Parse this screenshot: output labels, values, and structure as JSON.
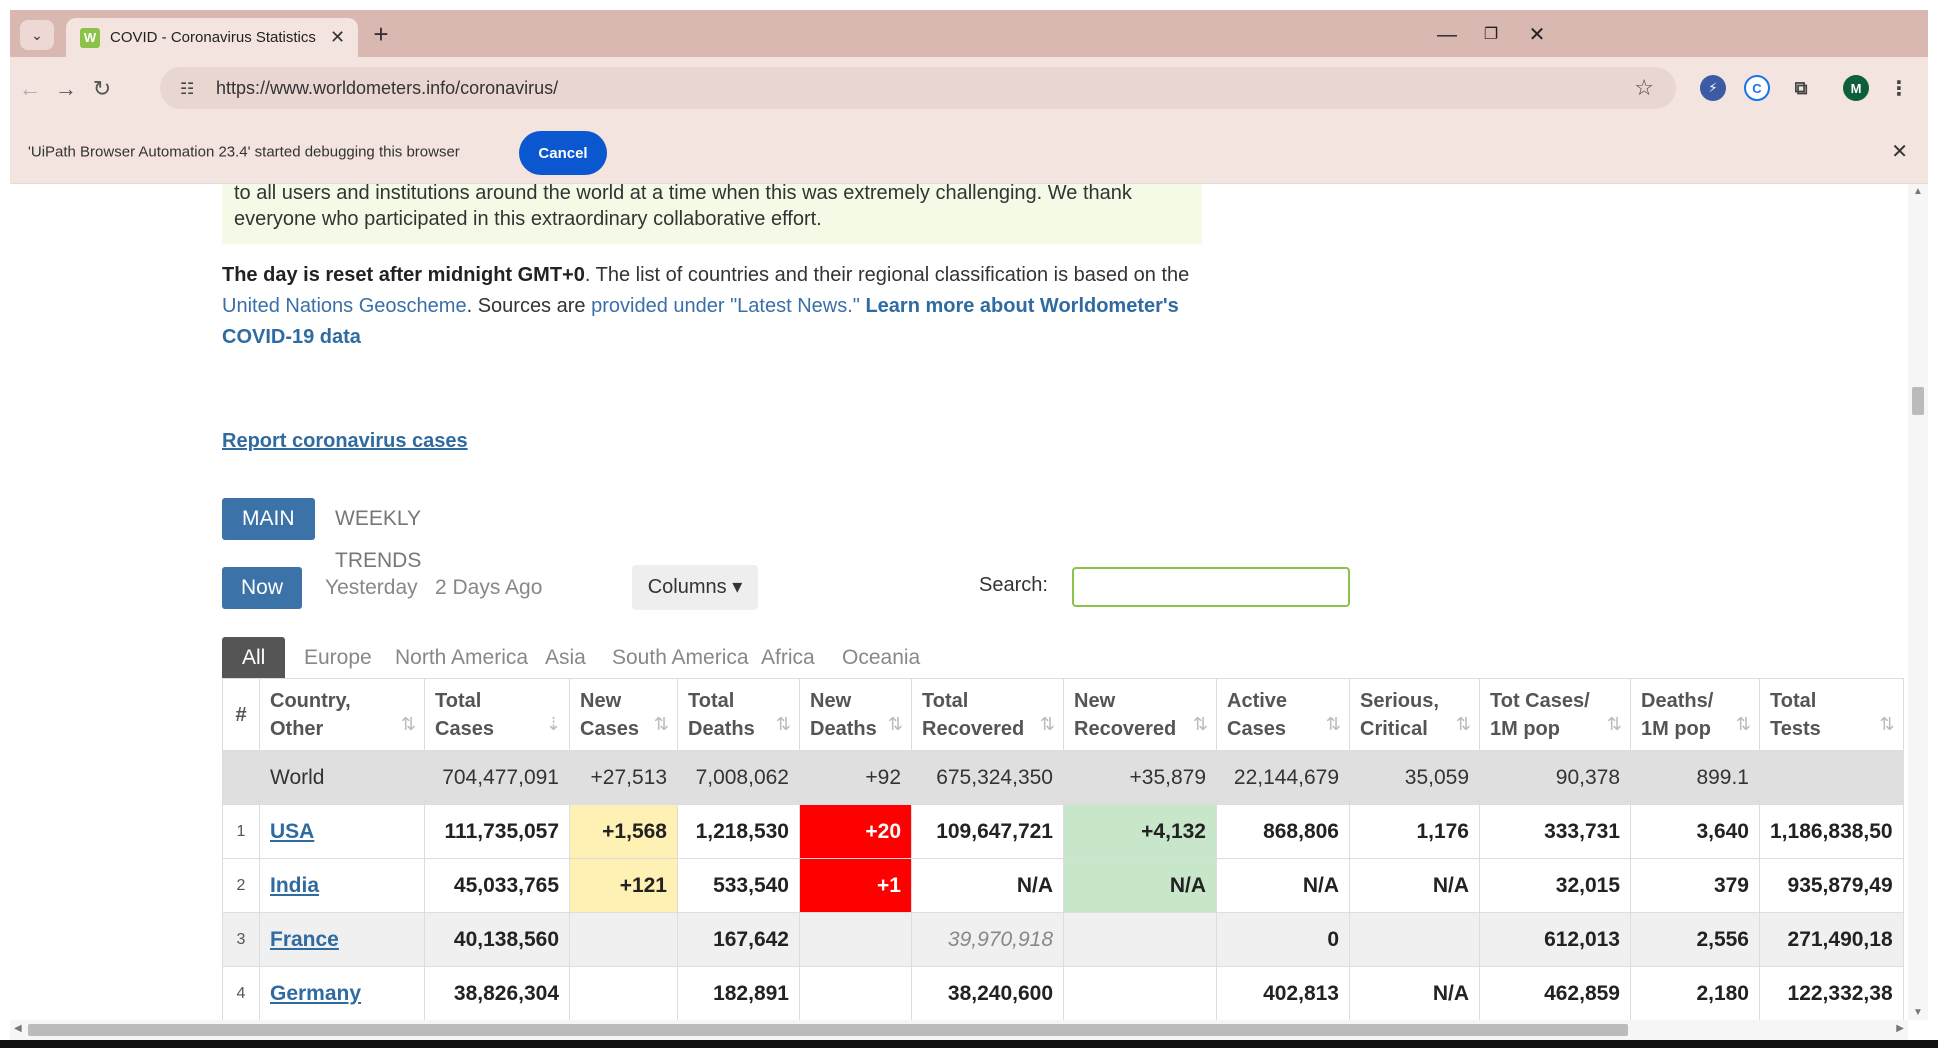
{
  "browser": {
    "tab_title": "COVID - Coronavirus Statistics -",
    "url": "https://www.worldometers.info/coronavirus/",
    "profile_initial": "M",
    "infobar_message": "'UiPath Browser Automation 23.4' started debugging this browser",
    "infobar_cancel": "Cancel"
  },
  "notice": {
    "line1": "to all users and institutions around the world at a time when this was extremely challenging. We thank",
    "line2": "everyone who participated in this extraordinary collaborative effort."
  },
  "info": {
    "bold_start": "The day is reset after midnight GMT+0",
    "text1": ". The list of countries and their regional classification is based on the ",
    "link_un": "United Nations Geoscheme",
    "text2": ". Sources are ",
    "link_sources": "provided under \"Latest News.\"",
    "text3": " ",
    "link_learn": "Learn more about Worldometer's COVID-19 data"
  },
  "report_link": "Report coronavirus cases",
  "view_tabs": [
    "MAIN",
    "WEEKLY TRENDS"
  ],
  "day_tabs": [
    "Now",
    "Yesterday",
    "2 Days Ago"
  ],
  "columns_label": "Columns ▾",
  "search_label": "Search:",
  "search_value": "",
  "region_tabs": [
    "All",
    "Europe",
    "North America",
    "Asia",
    "South America",
    "Africa",
    "Oceania"
  ],
  "table": {
    "headers": [
      {
        "l1": "#",
        "l2": ""
      },
      {
        "l1": "Country,",
        "l2": "Other"
      },
      {
        "l1": "Total",
        "l2": "Cases"
      },
      {
        "l1": "New",
        "l2": "Cases"
      },
      {
        "l1": "Total",
        "l2": "Deaths"
      },
      {
        "l1": "New",
        "l2": "Deaths"
      },
      {
        "l1": "Total",
        "l2": "Recovered"
      },
      {
        "l1": "New",
        "l2": "Recovered"
      },
      {
        "l1": "Active",
        "l2": "Cases"
      },
      {
        "l1": "Serious,",
        "l2": "Critical"
      },
      {
        "l1": "Tot Cases/",
        "l2": "1M pop"
      },
      {
        "l1": "Deaths/",
        "l2": "1M pop"
      },
      {
        "l1": "Total",
        "l2": "Tests"
      }
    ],
    "world": [
      "",
      "World",
      "704,477,091",
      "+27,513",
      "7,008,062",
      "+92",
      "675,324,350",
      "+35,879",
      "22,144,679",
      "35,059",
      "90,378",
      "899.1",
      ""
    ],
    "rows": [
      [
        "1",
        "USA",
        "111,735,057",
        "+1,568",
        "1,218,530",
        "+20",
        "109,647,721",
        "+4,132",
        "868,806",
        "1,176",
        "333,731",
        "3,640",
        "1,186,838,50"
      ],
      [
        "2",
        "India",
        "45,033,765",
        "+121",
        "533,540",
        "+1",
        "N/A",
        "N/A",
        "N/A",
        "N/A",
        "32,015",
        "379",
        "935,879,49"
      ],
      [
        "3",
        "France",
        "40,138,560",
        "",
        "167,642",
        "",
        "39,970,918",
        "",
        "0",
        "",
        "612,013",
        "2,556",
        "271,490,18"
      ],
      [
        "4",
        "Germany",
        "38,826,304",
        "",
        "182,891",
        "",
        "38,240,600",
        "",
        "402,813",
        "N/A",
        "462,859",
        "2,180",
        "122,332,38"
      ]
    ]
  }
}
